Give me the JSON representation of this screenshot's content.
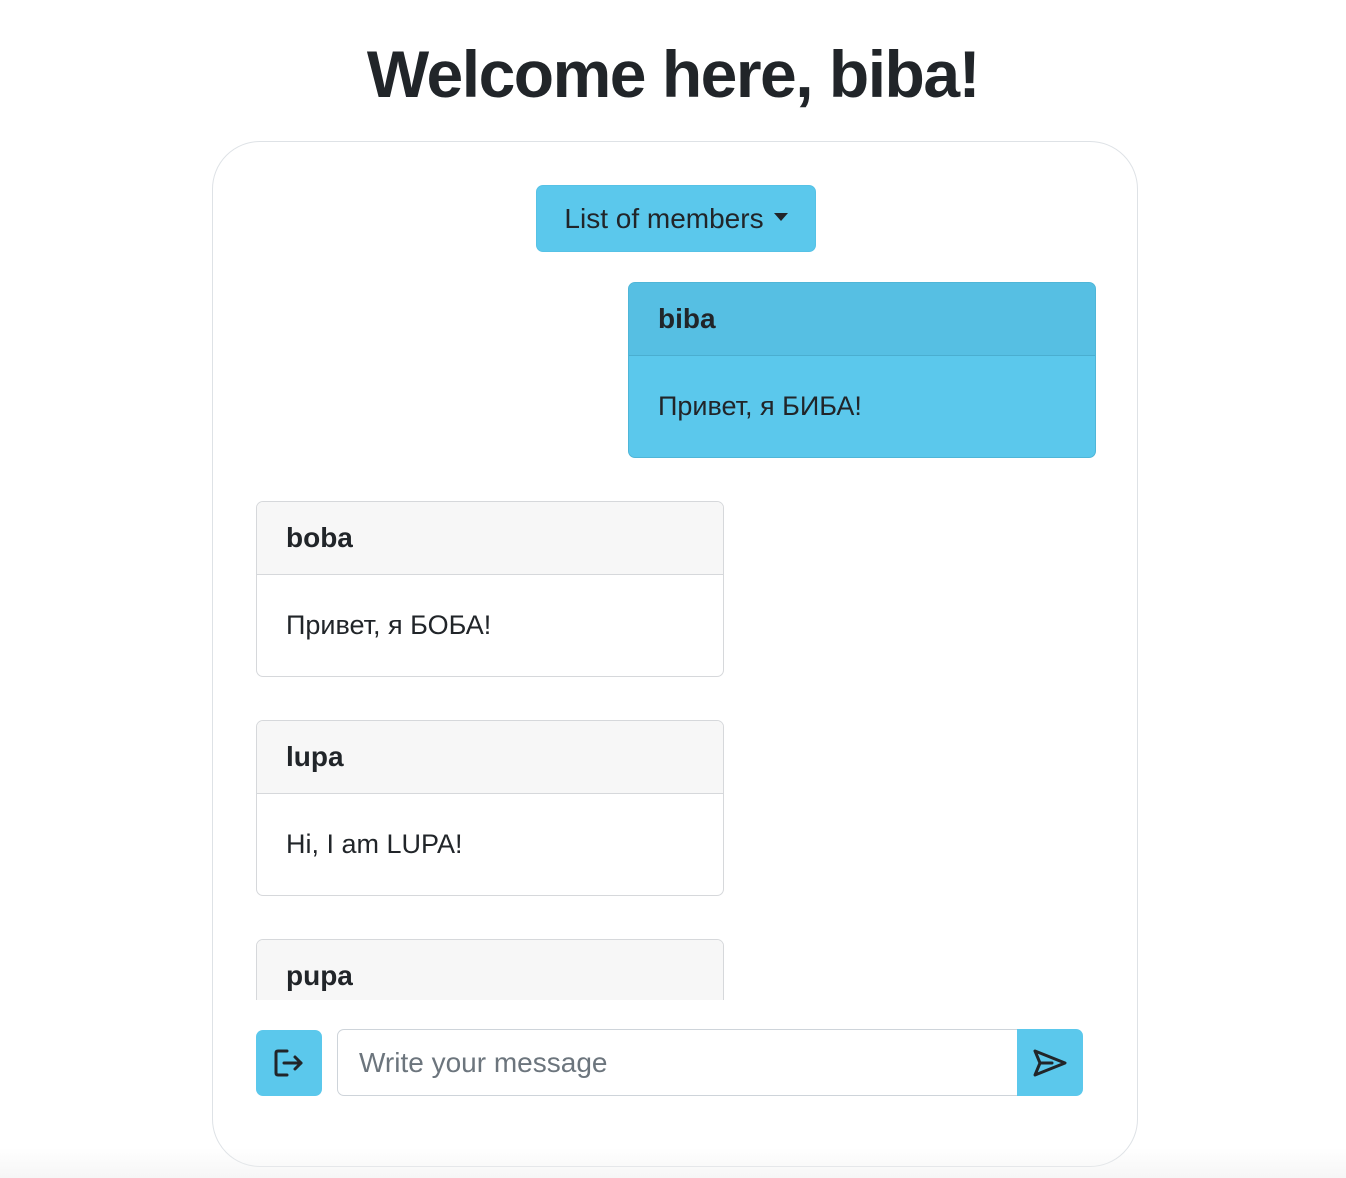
{
  "header": {
    "title": "Welcome here, biba!"
  },
  "chat": {
    "members_button_label": "List of members",
    "messages": [
      {
        "author": "biba",
        "text": "Привет, я БИБА!",
        "own": true
      },
      {
        "author": "boba",
        "text": "Привет, я БОБА!",
        "own": false
      },
      {
        "author": "lupa",
        "text": "Hi, I am LUPA!",
        "own": false
      },
      {
        "author": "pupa",
        "text": "",
        "own": false
      }
    ],
    "input": {
      "placeholder": "Write your message",
      "value": ""
    },
    "icons": {
      "logout": "box-arrow-right-icon",
      "send": "send-icon"
    }
  },
  "colors": {
    "accent": "#5bc8ec",
    "own_message_bg": "#5bc8ec",
    "other_message_header_bg": "#f7f7f7",
    "text": "#212529"
  }
}
